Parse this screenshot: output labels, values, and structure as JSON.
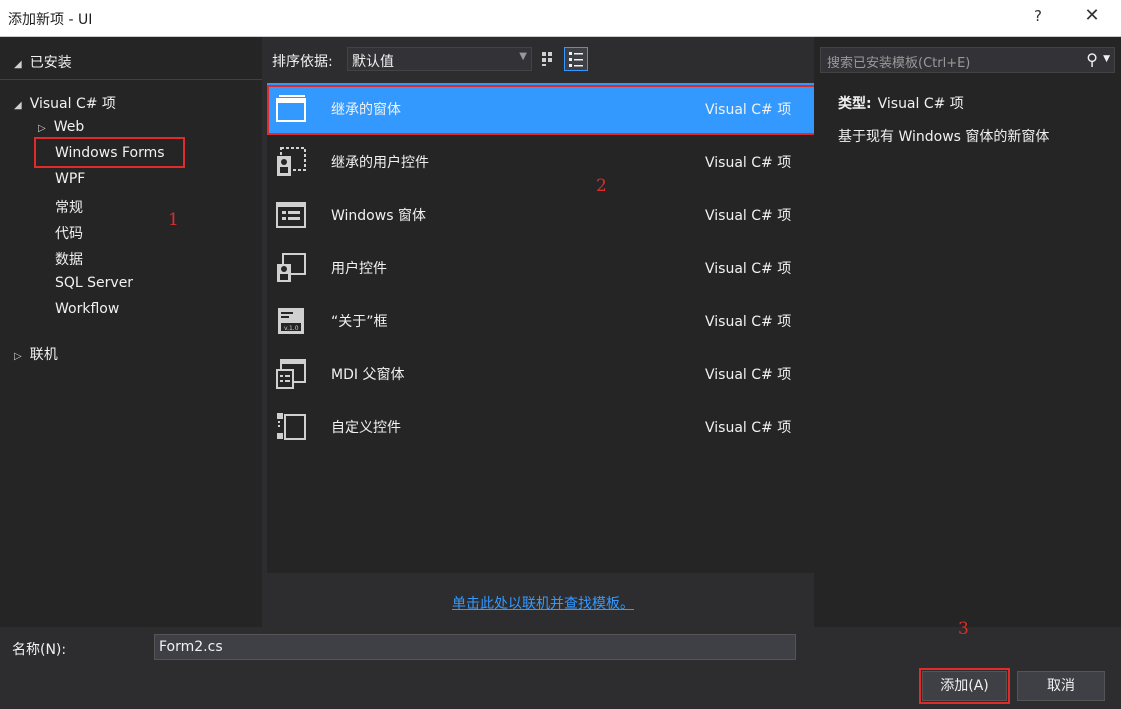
{
  "window": {
    "title": "添加新项 - UI",
    "help_glyph": "?",
    "close_glyph": "✕"
  },
  "left": {
    "installed_label": "已安装",
    "tree": [
      {
        "label": "Visual C# 项",
        "expander": "◢"
      },
      {
        "label": "Web",
        "expander": "▷"
      },
      {
        "label": "Windows Forms"
      },
      {
        "label": "WPF"
      },
      {
        "label": "常规"
      },
      {
        "label": "代码"
      },
      {
        "label": "数据"
      },
      {
        "label": "SQL Server"
      },
      {
        "label": "Workflow"
      },
      {
        "label": "联机",
        "expander": "▷"
      }
    ]
  },
  "sort": {
    "label": "排序依据:",
    "value": "默认值"
  },
  "templates": [
    {
      "name": "继承的窗体",
      "type": "Visual C# 项",
      "icon": "inherited-form-icon",
      "selected": true
    },
    {
      "name": "继承的用户控件",
      "type": "Visual C# 项",
      "icon": "inherited-user-control-icon"
    },
    {
      "name": "Windows 窗体",
      "type": "Visual C# 项",
      "icon": "windows-form-icon"
    },
    {
      "name": "用户控件",
      "type": "Visual C# 项",
      "icon": "user-control-icon"
    },
    {
      "name": "“关于”框",
      "type": "Visual C# 项",
      "icon": "about-box-icon"
    },
    {
      "name": "MDI 父窗体",
      "type": "Visual C# 项",
      "icon": "mdi-parent-icon"
    },
    {
      "name": "自定义控件",
      "type": "Visual C# 项",
      "icon": "custom-control-icon"
    }
  ],
  "online_link": "单击此处以联机并查找模板。",
  "search": {
    "placeholder": "搜索已安装模板(Ctrl+E)"
  },
  "description": {
    "type_label": "类型:",
    "type_value": "Visual C# 项",
    "text": "基于现有 Windows 窗体的新窗体"
  },
  "bottom": {
    "name_label": "名称(N):",
    "name_value": "Form2.cs",
    "add_label": "添加(A)",
    "cancel_label": "取消"
  },
  "annotations": [
    "1",
    "2",
    "3"
  ],
  "colors": {
    "selection": "#3399ff",
    "annotation_red": "#e02b2b",
    "link": "#3399ff"
  }
}
